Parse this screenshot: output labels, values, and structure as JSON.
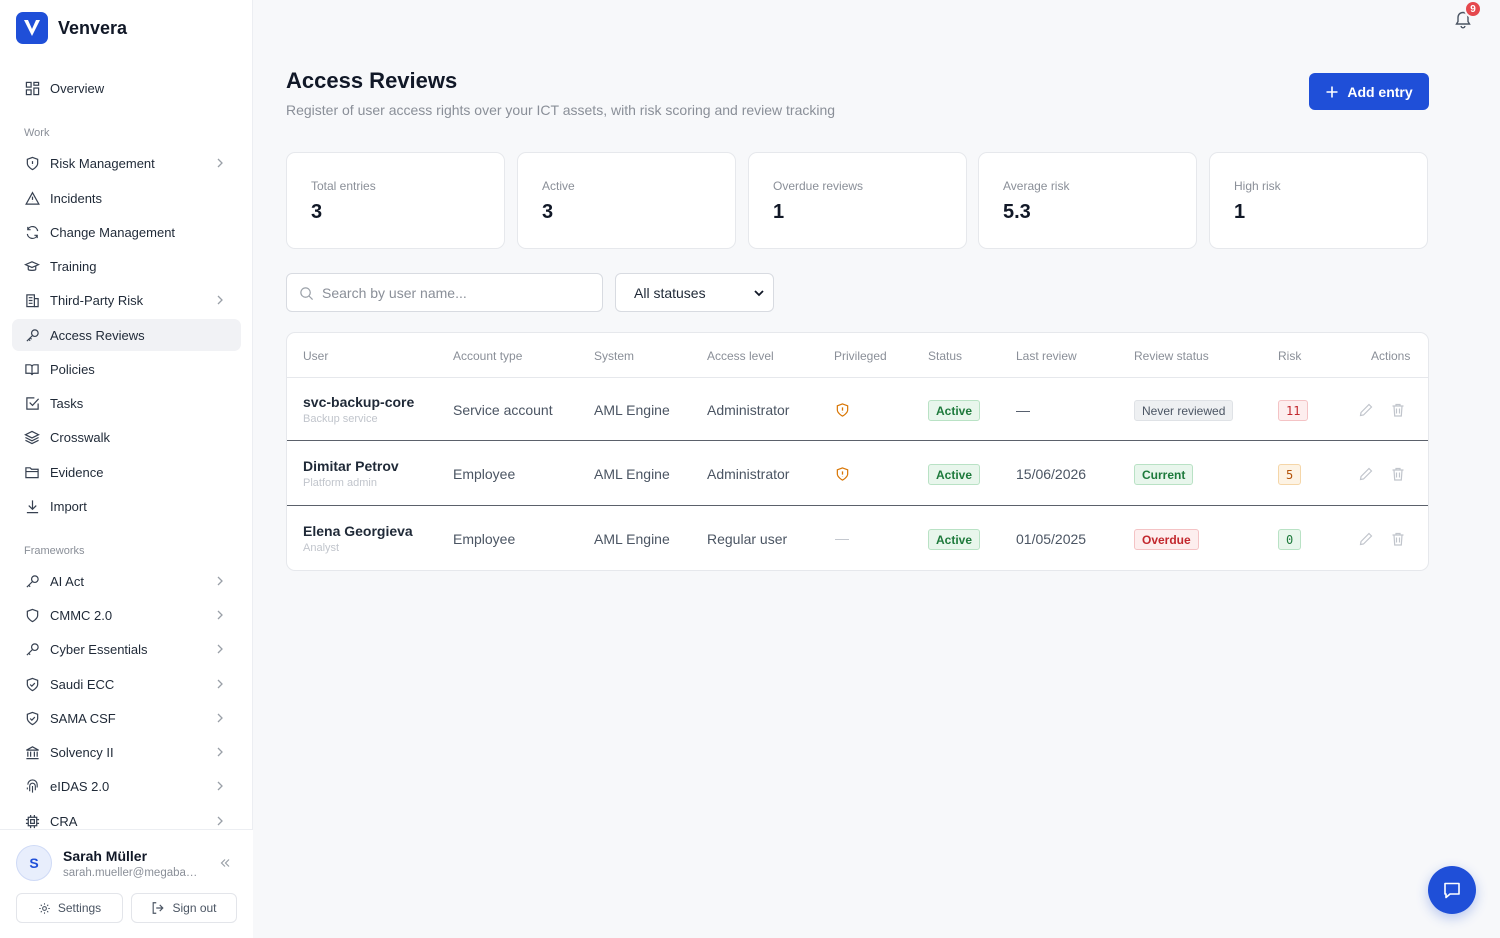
{
  "brand": {
    "name": "Venvera",
    "logo_letter": "V"
  },
  "sidebar": {
    "items": [
      {
        "label": "Overview",
        "icon": "grid-icon"
      },
      {
        "label": "Risk Management",
        "icon": "shield-icon",
        "chevron": true
      },
      {
        "label": "Incidents",
        "icon": "warning-icon"
      },
      {
        "label": "Change Management",
        "icon": "refresh-icon"
      },
      {
        "label": "Training",
        "icon": "graduation-cap-icon"
      },
      {
        "label": "Third-Party Risk",
        "icon": "building-icon",
        "chevron": true
      },
      {
        "label": "Access Reviews",
        "icon": "key-icon",
        "active": true
      },
      {
        "label": "Policies",
        "icon": "book-icon"
      },
      {
        "label": "Tasks",
        "icon": "checkbox-icon"
      },
      {
        "label": "Crosswalk",
        "icon": "layers-icon"
      },
      {
        "label": "Evidence",
        "icon": "folder-icon"
      },
      {
        "label": "Import",
        "icon": "download-icon"
      }
    ],
    "sections": {
      "work": "Work",
      "frameworks": "Frameworks"
    },
    "frameworks": [
      {
        "label": "AI Act",
        "icon": "key-icon"
      },
      {
        "label": "CMMC 2.0",
        "icon": "shield-icon"
      },
      {
        "label": "Cyber Essentials",
        "icon": "key-icon"
      },
      {
        "label": "Saudi ECC",
        "icon": "shield-check-icon"
      },
      {
        "label": "SAMA CSF",
        "icon": "shield-check-icon"
      },
      {
        "label": "Solvency II",
        "icon": "bank-icon"
      },
      {
        "label": "eIDAS 2.0",
        "icon": "fingerprint-icon"
      },
      {
        "label": "CRA",
        "icon": "chip-icon"
      }
    ]
  },
  "user": {
    "initial": "S",
    "name": "Sarah Müller",
    "email": "sarah.mueller@megabank.com",
    "settings_label": "Settings",
    "signout_label": "Sign out"
  },
  "notifications": {
    "count": "9"
  },
  "page": {
    "title": "Access Reviews",
    "subtitle": "Register of user access rights over your ICT assets, with risk scoring and review tracking",
    "add_label": "Add entry"
  },
  "stats": [
    {
      "label": "Total entries",
      "value": "3"
    },
    {
      "label": "Active",
      "value": "3"
    },
    {
      "label": "Overdue reviews",
      "value": "1"
    },
    {
      "label": "Average risk",
      "value": "5.3"
    },
    {
      "label": "High risk",
      "value": "1"
    }
  ],
  "filters": {
    "search_placeholder": "Search by user name...",
    "status_value": "All statuses"
  },
  "table": {
    "headers": [
      "User",
      "Account type",
      "System",
      "Access level",
      "Privileged",
      "Status",
      "Last review",
      "Review status",
      "Risk",
      "Actions"
    ],
    "rows": [
      {
        "user": "svc-backup-core",
        "sub": "Backup service",
        "account_type": "Service account",
        "system": "AML Engine",
        "access_level": "Administrator",
        "privileged": true,
        "status": "Active",
        "last_review": "—",
        "review_status": "Never reviewed",
        "review_kind": "gray",
        "risk": "11",
        "risk_kind": "red"
      },
      {
        "user": "Dimitar Petrov",
        "sub": "Platform admin",
        "account_type": "Employee",
        "system": "AML Engine",
        "access_level": "Administrator",
        "privileged": true,
        "status": "Active",
        "last_review": "15/06/2026",
        "review_status": "Current",
        "review_kind": "green",
        "risk": "5",
        "risk_kind": "orange"
      },
      {
        "user": "Elena Georgieva",
        "sub": "Analyst",
        "account_type": "Employee",
        "system": "AML Engine",
        "access_level": "Regular user",
        "privileged": false,
        "privileged_text": "—",
        "status": "Active",
        "last_review": "01/05/2025",
        "review_status": "Overdue",
        "review_kind": "red",
        "risk": "0",
        "risk_kind": "green"
      }
    ]
  },
  "colors": {
    "accent": "#1f4fd8",
    "badge": "#e5484d"
  }
}
